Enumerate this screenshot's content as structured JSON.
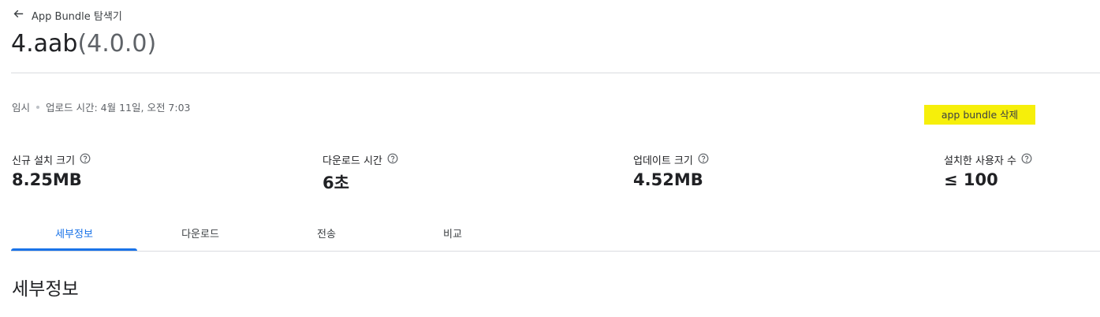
{
  "header": {
    "back_label": "App Bundle 탐색기",
    "title_name": "4.aab",
    "title_version": "(4.0.0)"
  },
  "meta": {
    "status": "임시",
    "upload_time": "업로드 시간: 4월 11일, 오전 7:03"
  },
  "actions": {
    "delete_label": "app bundle 삭제"
  },
  "stats": [
    {
      "label": "신규 설치 크기",
      "value": "8.25MB"
    },
    {
      "label": "다운로드 시간",
      "value": "6초"
    },
    {
      "label": "업데이트 크기",
      "value": "4.52MB"
    },
    {
      "label": "설치한 사용자 수",
      "value": "≤ 100"
    }
  ],
  "tabs": [
    {
      "label": "세부정보",
      "active": true
    },
    {
      "label": "다운로드",
      "active": false
    },
    {
      "label": "전송",
      "active": false
    },
    {
      "label": "비교",
      "active": false
    }
  ],
  "section": {
    "title": "세부정보"
  },
  "colors": {
    "accent": "#1a73e8",
    "highlight": "#f6ef0a",
    "divider": "#dadce0"
  }
}
